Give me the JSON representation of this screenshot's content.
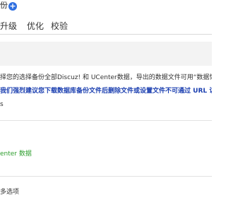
{
  "header": {
    "title_fragment": "份",
    "add_icon_glyph": "+"
  },
  "tabs": [
    {
      "label": "升级"
    },
    {
      "label": "优化"
    },
    {
      "label": "校验"
    }
  ],
  "content": {
    "tip_text": "择您的选择备份全部Discuz! 和 UCenter数据，导出的数据文件可用“数据恢复”功能或 pl",
    "warning_text": "我们强烈建议您下载数据库备份文件后删除文件或设置文件不可通过 URL 访问。",
    "fragment_s": "s",
    "option_ucenter": "enter 数据",
    "more_options": "多选项"
  },
  "colors": {
    "accent": "#2f6fe0",
    "warning_text": "#1b3fb0",
    "option_green": "#2e9e2e",
    "section_bg": "#f3f3f3"
  }
}
